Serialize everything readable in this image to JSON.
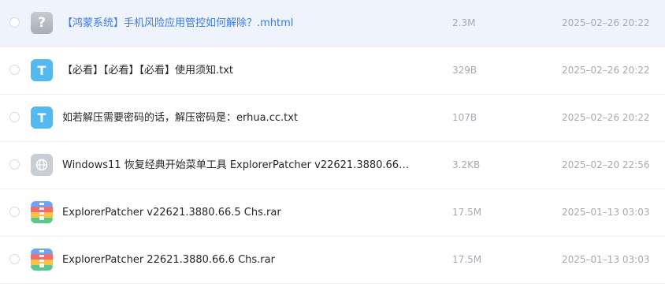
{
  "files": [
    {
      "name": "【鸿蒙系统】手机风险应用管控如何解除？.mhtml",
      "size": "2.3M",
      "date": "2025–02–26 20:22",
      "icon": "unknown-file-icon",
      "icon_text": "?"
    },
    {
      "name": "【必看】【必看】【必看】使用须知.txt",
      "size": "329B",
      "date": "2025–02–26 20:22",
      "icon": "text-file-icon",
      "icon_text": "T"
    },
    {
      "name": "如若解压需要密码的话，解压密码是：erhua.cc.txt",
      "size": "107B",
      "date": "2025–02–26 20:22",
      "icon": "text-file-icon",
      "icon_text": "T"
    },
    {
      "name": "Windows11 恢复经典开始菜单工具 ExplorerPatcher v22621.3880.66…",
      "size": "3.2KB",
      "date": "2025–02–20 22:56",
      "icon": "web-link-icon",
      "icon_text": ""
    },
    {
      "name": "ExplorerPatcher v22621.3880.66.5 Chs.rar",
      "size": "17.5M",
      "date": "2025–01–13 03:03",
      "icon": "archive-file-icon",
      "icon_text": ""
    },
    {
      "name": "ExplorerPatcher 22621.3880.66.6 Chs.rar",
      "size": "17.5M",
      "date": "2025–01–13 03:03",
      "icon": "archive-file-icon",
      "icon_text": ""
    }
  ],
  "colors": {
    "hover_row": "#eef3fd",
    "link_blue": "#3b7be8",
    "txt_icon": "#54b9f0",
    "meta_text": "#a4a9b3"
  }
}
